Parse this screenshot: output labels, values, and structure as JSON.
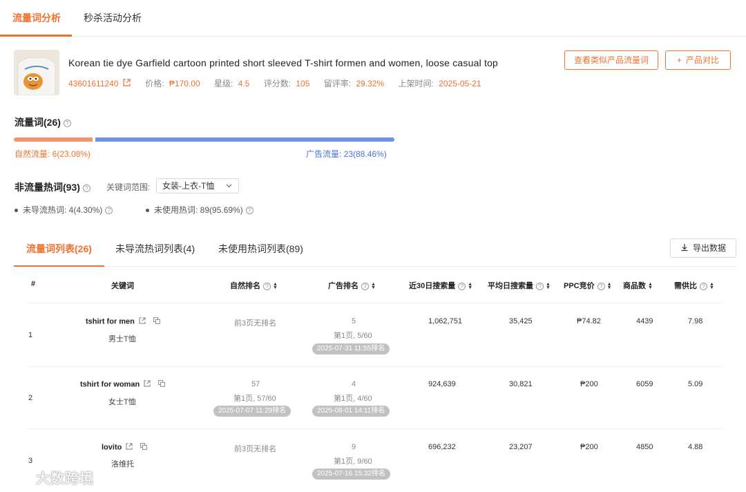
{
  "top_tabs": [
    {
      "label": "流量词分析"
    },
    {
      "label": "秒杀活动分析"
    }
  ],
  "product": {
    "title": "Korean tie dye Garfield cartoon printed short sleeved T-shirt formen and women, loose casual top",
    "id": "43601611240",
    "price_label": "价格:",
    "price": "₱170.00",
    "rating_label": "星级:",
    "rating": "4.5",
    "reviews_label": "评分数:",
    "reviews": "105",
    "review_rate_label": "留评率:",
    "review_rate": "29.32%",
    "listed_label": "上架时间:",
    "listed": "2025-05-21"
  },
  "actions": {
    "similar_label": "查看类似产品流量词",
    "compare_label": "产品对比",
    "compare_icon": "+"
  },
  "traffic": {
    "title": "流量词(26)",
    "organic_label": "自然流量: ",
    "organic_value": "6(23.08%)",
    "organic_fraction": 0.2308,
    "ad_label": "广告流量: ",
    "ad_value": "23(88.46%)",
    "organic_color": "#f29468",
    "ad_color": "#6f90e8"
  },
  "non_traffic": {
    "title": "非流量热词(93)",
    "scope_label": "关键词范围:",
    "scope_value": "女装-上衣-T恤",
    "unused_hot_label": "未导流热词: ",
    "unused_hot_value": "4(4.30%)",
    "not_used_label": "未使用热词: ",
    "not_used_value": "89(95.69%)"
  },
  "list_tabs": [
    {
      "label": "流量词列表(26)"
    },
    {
      "label": "未导流热词列表(4)"
    },
    {
      "label": "未使用热词列表(89)"
    }
  ],
  "export_label": "导出数据",
  "table": {
    "headers": [
      "#",
      "关键词",
      "自然排名",
      "广告排名",
      "近30日搜索量",
      "平均日搜索量",
      "PPC竞价",
      "商品数",
      "需供比"
    ],
    "rows": [
      {
        "index": "1",
        "keyword": "tshirt for men",
        "keyword_cn": "男士T恤",
        "organic_main": "前3页无排名",
        "organic_sub": "",
        "organic_ts": "",
        "ad_main": "5",
        "ad_sub": "第1页, 5/60",
        "ad_ts": "2025-07-31 11:55排名",
        "search30": "1,062,751",
        "daily": "35,425",
        "ppc": "₱74.82",
        "products": "4439",
        "ratio": "7.98"
      },
      {
        "index": "2",
        "keyword": "tshirt for woman",
        "keyword_cn": "女士T恤",
        "organic_main": "57",
        "organic_sub": "第1页, 57/60",
        "organic_ts": "2025-07-07 11:29排名",
        "ad_main": "4",
        "ad_sub": "第1页, 4/60",
        "ad_ts": "2025-08-01 14:11排名",
        "search30": "924,639",
        "daily": "30,821",
        "ppc": "₱200",
        "products": "6059",
        "ratio": "5.09"
      },
      {
        "index": "3",
        "keyword": "lovito",
        "keyword_cn": "洛维托",
        "organic_main": "前3页无排名",
        "organic_sub": "",
        "organic_ts": "",
        "ad_main": "9",
        "ad_sub": "第1页, 9/60",
        "ad_ts": "2025-07-16 15:32排名",
        "search30": "696,232",
        "daily": "23,207",
        "ppc": "₱200",
        "products": "4850",
        "ratio": "4.88"
      }
    ]
  },
  "watermark": "大数跨境",
  "accent_color": "#f0712e"
}
